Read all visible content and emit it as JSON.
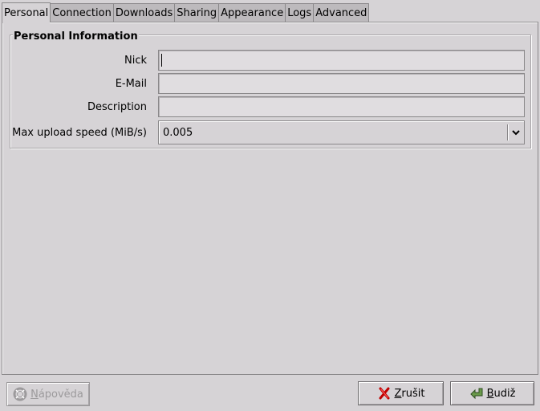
{
  "tabs": [
    {
      "label": "Personal",
      "active": true
    },
    {
      "label": "Connection"
    },
    {
      "label": "Downloads"
    },
    {
      "label": "Sharing"
    },
    {
      "label": "Appearance"
    },
    {
      "label": "Logs"
    },
    {
      "label": "Advanced"
    }
  ],
  "personal": {
    "frame_title": "Personal Information",
    "nick_label": "Nick",
    "nick_value": "",
    "email_label": "E-Mail",
    "email_value": "",
    "description_label": "Description",
    "description_value": "",
    "upload_label": "Max upload speed (MiB/s)",
    "upload_value": "0.005"
  },
  "buttons": {
    "help_underlined": "N",
    "help_rest": "ápověda",
    "cancel_underlined": "Z",
    "cancel_rest": "rušit",
    "ok_underlined": "B",
    "ok_rest": "udiž"
  },
  "icons": {
    "help": "lifebuoy-icon",
    "cancel": "red-x-icon",
    "ok": "green-check-arrow-icon",
    "dropdown": "chevron-down-icon"
  },
  "colors": {
    "background": "#d6d3d6",
    "entry_bg": "#e0dde0",
    "cancel_red": "#c00000",
    "ok_green": "#4a7a3a"
  }
}
